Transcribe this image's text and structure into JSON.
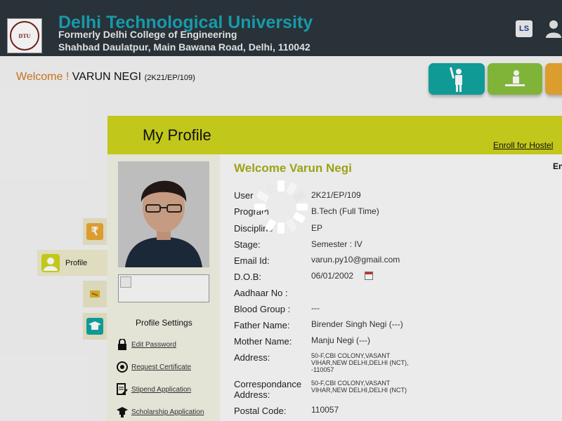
{
  "header": {
    "logo_text": "DTU",
    "university_name": "Delhi Technological University",
    "subtitle": "Formerly Delhi College of Engineering",
    "address": "Shahbad Daulatpur, Main Bawana Road, Delhi, 110042",
    "icon_badge": "LS"
  },
  "welcome": {
    "prefix": "Welcome !",
    "name": "VARUN NEGI",
    "roll": "(2K21/EP/109)"
  },
  "profile": {
    "title": "My Profile",
    "enroll_link": "Enroll for Hostel",
    "greeting": "Welcome Varun Negi",
    "right_cut_text": "En",
    "fields": [
      {
        "label": "User",
        "value": "2K21/EP/109"
      },
      {
        "label": "Program",
        "value": "B.Tech (Full Time)"
      },
      {
        "label": "Discipline",
        "value": "EP"
      },
      {
        "label": "Stage:",
        "value": "Semester : IV"
      },
      {
        "label": "Email Id:",
        "value": "varun.py10@gmail.com"
      },
      {
        "label": "D.O.B:",
        "value": "06/01/2002"
      },
      {
        "label": "Aadhaar No :",
        "value": ""
      },
      {
        "label": "Blood Group :",
        "value": "---"
      },
      {
        "label": "Father Name:",
        "value": "Birender Singh Negi (---)"
      },
      {
        "label": "Mother Name:",
        "value": "Manju Negi (---)"
      }
    ],
    "address_label": "Address:",
    "address_line1": "50-F,CBI COLONY,VASANT",
    "address_line2": "VIHAR,NEW DELHI,DELHI (NCT),",
    "address_line3": "-110057",
    "corr_label_1": "Correspondance",
    "corr_label_2": "Address:",
    "corr_line1": "50-F,CBI COLONY,VASANT",
    "corr_line2": "VIHAR,NEW DELHI,DELHI (NCT)",
    "postal_label": "Postal Code:",
    "postal_value": "110057"
  },
  "settings": {
    "title": "Profile Settings",
    "links": [
      {
        "label": "Edit Password",
        "icon": "lock-icon"
      },
      {
        "label": "Request Certificate",
        "icon": "certificate-icon"
      },
      {
        "label": "Stipend Application",
        "icon": "document-edit-icon"
      },
      {
        "label": "Scholarship Application",
        "icon": "graduation-cap-icon"
      }
    ]
  },
  "sidenav": {
    "profile_label": "Profile",
    "rupee_symbol": "₹"
  },
  "colors": {
    "header_bg": "#2b363c",
    "brand_teal": "#1aa3b5",
    "profile_band": "#cfd41d",
    "welcome_orange": "#d07a1e",
    "greeting_olive": "#a6ad16"
  }
}
